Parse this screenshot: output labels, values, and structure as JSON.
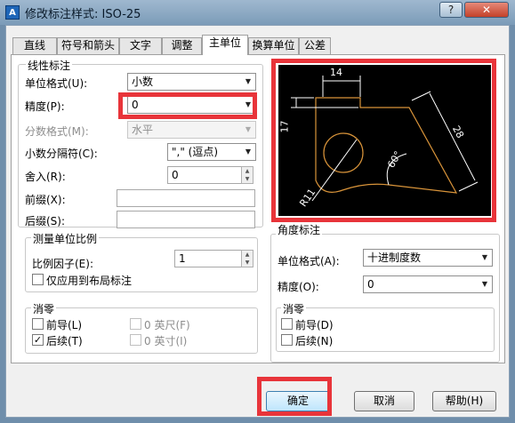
{
  "window": {
    "title": "修改标注样式: ISO-25",
    "app_icon_text": "A",
    "help_btn": "?",
    "close_btn": "✕"
  },
  "tabs": [
    "直线",
    "符号和箭头",
    "文字",
    "调整",
    "主单位",
    "换算单位",
    "公差"
  ],
  "active_tab": "主单位",
  "linear": {
    "group_title": "线性标注",
    "unit_format_label": "单位格式(U):",
    "unit_format_value": "小数",
    "precision_label": "精度(P):",
    "precision_value": "0",
    "fraction_format_label": "分数格式(M):",
    "fraction_format_value": "水平",
    "decimal_sep_label": "小数分隔符(C):",
    "decimal_sep_value": "\",\" (逗点)",
    "round_label": "舍入(R):",
    "round_value": "0",
    "prefix_label": "前缀(X):",
    "prefix_value": "",
    "suffix_label": "后缀(S):",
    "suffix_value": ""
  },
  "scale": {
    "group_title": "测量单位比例",
    "factor_label": "比例因子(E):",
    "factor_value": "1",
    "layout_only_label": "仅应用到布局标注"
  },
  "zero_left": {
    "group_title": "消零",
    "leading_label": "前导(L)",
    "trailing_label": "后续(T)",
    "feet_label": "0 英尺(F)",
    "inches_label": "0 英寸(I)"
  },
  "angular": {
    "group_title": "角度标注",
    "unit_format_label": "单位格式(A):",
    "unit_format_value": "十进制度数",
    "precision_label": "精度(O):",
    "precision_value": "0"
  },
  "zero_right": {
    "group_title": "消零",
    "leading_label": "前导(D)",
    "trailing_label": "后续(N)"
  },
  "preview": {
    "dim_top": "14",
    "dim_left": "17",
    "dim_right": "28",
    "dim_angle": "60°",
    "dim_radius": "R11"
  },
  "buttons": {
    "ok": "确定",
    "cancel": "取消",
    "help": "帮助(H)"
  },
  "checkbox_states": {
    "layout_only": false,
    "left_leading": false,
    "left_trailing": true,
    "feet": false,
    "inches": false,
    "right_leading": false,
    "right_trailing": false
  },
  "colors": {
    "highlight_red": "#e8343a",
    "preview_lines": "#ffffff",
    "preview_shape": "#d9943a"
  }
}
